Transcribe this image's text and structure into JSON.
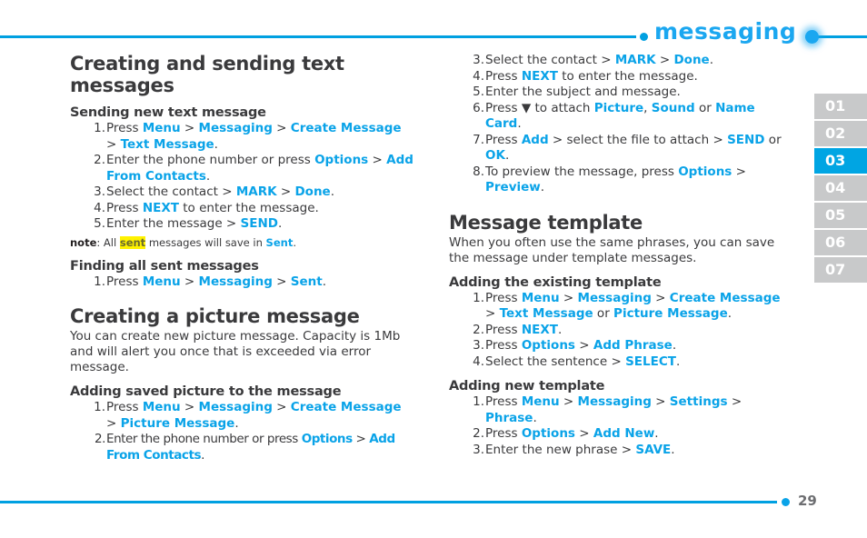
{
  "header": {
    "title": "messaging",
    "accent_color": "#00a0e1",
    "title_color": "#1ba7f0"
  },
  "footer": {
    "page_number": "29"
  },
  "tabs": {
    "active_index": 2,
    "items": [
      "01",
      "02",
      "03",
      "04",
      "05",
      "06",
      "07"
    ]
  },
  "left_column": {
    "section_title": "Creating and sending text messages",
    "sending_new": {
      "heading": "Sending new text message",
      "steps": [
        [
          {
            "t": "Press ",
            "k": false
          },
          {
            "t": "Menu",
            "k": true
          },
          {
            "t": " > ",
            "k": false
          },
          {
            "t": "Messaging",
            "k": true
          },
          {
            "t": " > ",
            "k": false
          },
          {
            "t": "Create Message",
            "k": true
          },
          {
            "t": " > ",
            "k": false
          },
          {
            "t": "Text Message",
            "k": true
          },
          {
            "t": ".",
            "k": false
          }
        ],
        [
          {
            "t": "Enter the phone number or press ",
            "k": false
          },
          {
            "t": "Options",
            "k": true
          },
          {
            "t": " > ",
            "k": false
          },
          {
            "t": "Add From Contacts",
            "k": true
          },
          {
            "t": ".",
            "k": false
          }
        ],
        [
          {
            "t": "Select the contact > ",
            "k": false
          },
          {
            "t": "MARK",
            "k": true
          },
          {
            "t": " > ",
            "k": false
          },
          {
            "t": "Done",
            "k": true
          },
          {
            "t": ".",
            "k": false
          }
        ],
        [
          {
            "t": "Press ",
            "k": false
          },
          {
            "t": "NEXT",
            "k": true
          },
          {
            "t": " to enter the message.",
            "k": false
          }
        ],
        [
          {
            "t": "Enter the message > ",
            "k": false
          },
          {
            "t": "SEND",
            "k": true
          },
          {
            "t": ".",
            "k": false
          }
        ]
      ],
      "note_label": "note",
      "note_pre": ": All ",
      "note_highlight": "sent",
      "note_mid": " messages will save in ",
      "note_keyword": "Sent",
      "note_end": "."
    },
    "finding_sent": {
      "heading": "Finding all sent messages",
      "steps": [
        [
          {
            "t": "Press ",
            "k": false
          },
          {
            "t": "Menu",
            "k": true
          },
          {
            "t": " > ",
            "k": false
          },
          {
            "t": "Messaging",
            "k": true
          },
          {
            "t": " > ",
            "k": false
          },
          {
            "t": "Sent",
            "k": true
          },
          {
            "t": ".",
            "k": false
          }
        ]
      ]
    },
    "picture_section_title": "Creating a picture message",
    "picture_intro": "You can create new picture message. Capacity is 1Mb and will alert you once that is exceeded via error message.",
    "adding_saved": {
      "heading": "Adding saved picture to the message",
      "steps": [
        [
          {
            "t": "Press ",
            "k": false
          },
          {
            "t": "Menu",
            "k": true
          },
          {
            "t": " > ",
            "k": false
          },
          {
            "t": "Messaging",
            "k": true
          },
          {
            "t": " > ",
            "k": false
          },
          {
            "t": "Create Message",
            "k": true
          },
          {
            "t": " > ",
            "k": false
          },
          {
            "t": "Picture Message",
            "k": true
          },
          {
            "t": ".",
            "k": false
          }
        ],
        [
          {
            "t": "Enter the phone number or press ",
            "k": false
          },
          {
            "t": "Options",
            "k": true
          },
          {
            "t": " > ",
            "k": false
          },
          {
            "t": "Add From Contacts",
            "k": true
          },
          {
            "t": ".",
            "k": false
          }
        ]
      ]
    }
  },
  "right_column": {
    "continued_steps_start": 3,
    "continued_steps": [
      [
        {
          "t": "Select the contact > ",
          "k": false
        },
        {
          "t": "MARK",
          "k": true
        },
        {
          "t": " > ",
          "k": false
        },
        {
          "t": "Done",
          "k": true
        },
        {
          "t": ".",
          "k": false
        }
      ],
      [
        {
          "t": "Press ",
          "k": false
        },
        {
          "t": "NEXT",
          "k": true
        },
        {
          "t": " to enter the message.",
          "k": false
        }
      ],
      [
        {
          "t": "Enter the subject and message.",
          "k": false
        }
      ],
      [
        {
          "t": "Press ",
          "k": false
        },
        {
          "t": "▼",
          "k": false
        },
        {
          "t": " to attach ",
          "k": false
        },
        {
          "t": "Picture",
          "k": true
        },
        {
          "t": ", ",
          "k": false
        },
        {
          "t": "Sound",
          "k": true
        },
        {
          "t": " or ",
          "k": false
        },
        {
          "t": "Name Card",
          "k": true
        },
        {
          "t": ".",
          "k": false
        }
      ],
      [
        {
          "t": "Press ",
          "k": false
        },
        {
          "t": "Add",
          "k": true
        },
        {
          "t": " > select the file to attach > ",
          "k": false
        },
        {
          "t": "SEND",
          "k": true
        },
        {
          "t": " or ",
          "k": false
        },
        {
          "t": "OK",
          "k": true
        },
        {
          "t": ".",
          "k": false
        }
      ],
      [
        {
          "t": "To preview the message, press ",
          "k": false
        },
        {
          "t": "Options",
          "k": true
        },
        {
          "t": " > ",
          "k": false
        },
        {
          "t": "Preview",
          "k": true
        },
        {
          "t": ".",
          "k": false
        }
      ]
    ],
    "template_section_title": "Message template",
    "template_intro": "When you often use the same phrases, you can save the message under template messages.",
    "adding_existing": {
      "heading": "Adding the existing template",
      "steps": [
        [
          {
            "t": "Press ",
            "k": false
          },
          {
            "t": "Menu",
            "k": true
          },
          {
            "t": " > ",
            "k": false
          },
          {
            "t": "Messaging",
            "k": true
          },
          {
            "t": " > ",
            "k": false
          },
          {
            "t": "Create Message",
            "k": true
          },
          {
            "t": " > ",
            "k": false
          },
          {
            "t": "Text Message",
            "k": true
          },
          {
            "t": " or ",
            "k": false
          },
          {
            "t": "Picture Message",
            "k": true
          },
          {
            "t": ".",
            "k": false
          }
        ],
        [
          {
            "t": "Press ",
            "k": false
          },
          {
            "t": "NEXT",
            "k": true
          },
          {
            "t": ".",
            "k": false
          }
        ],
        [
          {
            "t": "Press ",
            "k": false
          },
          {
            "t": "Options",
            "k": true
          },
          {
            "t": " > ",
            "k": false
          },
          {
            "t": "Add Phrase",
            "k": true
          },
          {
            "t": ".",
            "k": false
          }
        ],
        [
          {
            "t": "Select the sentence > ",
            "k": false
          },
          {
            "t": "SELECT",
            "k": true
          },
          {
            "t": ".",
            "k": false
          }
        ]
      ]
    },
    "adding_new": {
      "heading": "Adding new template",
      "steps": [
        [
          {
            "t": "Press ",
            "k": false
          },
          {
            "t": "Menu",
            "k": true
          },
          {
            "t": " > ",
            "k": false
          },
          {
            "t": "Messaging",
            "k": true
          },
          {
            "t": " > ",
            "k": false
          },
          {
            "t": "Settings",
            "k": true
          },
          {
            "t": " > ",
            "k": false
          },
          {
            "t": "Phrase",
            "k": true
          },
          {
            "t": ".",
            "k": false
          }
        ],
        [
          {
            "t": "Press ",
            "k": false
          },
          {
            "t": "Options",
            "k": true
          },
          {
            "t": " > ",
            "k": false
          },
          {
            "t": "Add New",
            "k": true
          },
          {
            "t": ".",
            "k": false
          }
        ],
        [
          {
            "t": "Enter the new phrase > ",
            "k": false
          },
          {
            "t": "SAVE",
            "k": true
          },
          {
            "t": ".",
            "k": false
          }
        ]
      ]
    }
  }
}
